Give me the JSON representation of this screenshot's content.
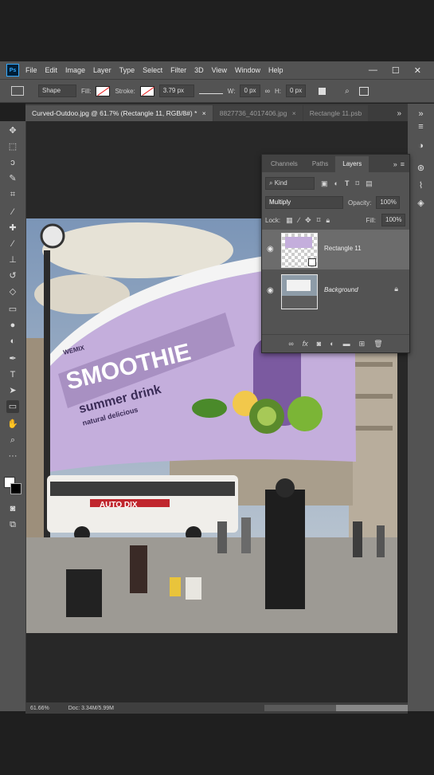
{
  "app": {
    "logo": "Ps"
  },
  "menu": [
    "File",
    "Edit",
    "Image",
    "Layer",
    "Type",
    "Select",
    "Filter",
    "3D",
    "View",
    "Window",
    "Help"
  ],
  "window_controls": [
    "—",
    "☐",
    "✕"
  ],
  "options": {
    "mode": "Shape",
    "fill_label": "Fill:",
    "stroke_label": "Stroke:",
    "stroke_width": "3.79 px",
    "w_label": "W:",
    "w_value": "0 px",
    "h_label": "H:",
    "h_value": "0 px"
  },
  "tabs": [
    {
      "label": "Curved-Outdoo.jpg @ 61.7% (Rectangle 11, RGB/8#) *",
      "close": "×",
      "active": true
    },
    {
      "label": "8827736_4017406.jpg",
      "close": "×",
      "active": false
    },
    {
      "label": "Rectangle 11.psb",
      "close": "",
      "active": false
    }
  ],
  "tab_overflow": "»",
  "billboard": {
    "brand": "WEMIX",
    "headline": "SMOOTHIE",
    "sub1": "summer drink",
    "sub2": "natural delicious",
    "small": "",
    "bg": "#c4aedc"
  },
  "bus_text": "AUTO DIX",
  "layers_panel": {
    "tabs": [
      "Channels",
      "Paths",
      "Layers"
    ],
    "active_tab": "Layers",
    "filter": "Kind",
    "blend_mode": "Multiply",
    "opacity_label": "Opacity:",
    "opacity": "100%",
    "lock_label": "Lock:",
    "fill_label": "Fill:",
    "fill": "100%",
    "layers": [
      {
        "name": "Rectangle 11",
        "selected": true,
        "visible": true
      },
      {
        "name": "Background",
        "selected": false,
        "visible": true,
        "locked": true
      }
    ]
  },
  "status": {
    "zoom": "61.66%",
    "doc": "Doc: 3.34M/5.99M"
  },
  "colors": {
    "accent": "#31a8ff",
    "ui_bg": "#535353",
    "dark_bg": "#282828"
  }
}
